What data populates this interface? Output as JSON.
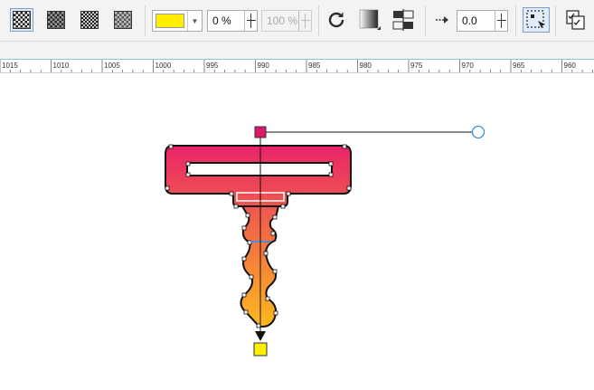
{
  "toolbar": {
    "transparency_types": [
      {
        "name": "Two-color pattern",
        "selected": true
      },
      {
        "name": "Bitmap pattern",
        "selected": false
      },
      {
        "name": "Full-color pattern",
        "selected": false
      },
      {
        "name": "Texture",
        "selected": false
      }
    ],
    "color_swatch": "#ffee00",
    "opacity_value": "0 %",
    "opacity_end_value": "100 %",
    "angle_value": "0.0",
    "icons": [
      "checker-icon",
      "refresh-icon",
      "gradient-icon",
      "align-icon",
      "arrow-right-icon",
      "select-icon",
      "copy-icon"
    ]
  },
  "ruler": {
    "labels": [
      "1015",
      "1010",
      "1005",
      "1000",
      "995",
      "990",
      "985",
      "980",
      "975",
      "970",
      "965",
      "960"
    ]
  },
  "canvas": {
    "gradient_start": "#e8196e",
    "gradient_end": "#ffcc14",
    "handle_start_color": "#e0186c",
    "handle_end_color": "#ffee00"
  }
}
